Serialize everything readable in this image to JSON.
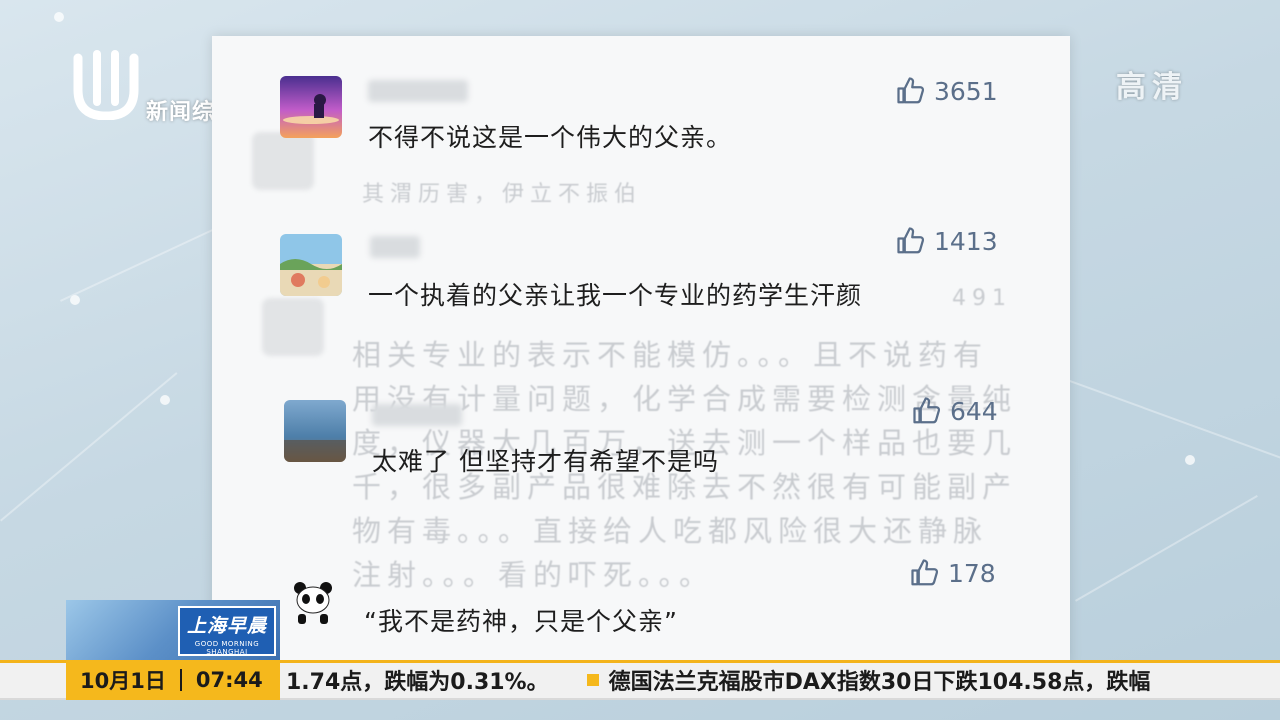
{
  "channel": {
    "logo_text": "新闻综合",
    "hd_label": "高清"
  },
  "comments": [
    {
      "avatar": "sunset-avatar",
      "likes": "3651",
      "text": "不得不说这是一个伟大的父亲。"
    },
    {
      "avatar": "landscape-avatar",
      "likes": "1413",
      "text": "一个执着的父亲让我一个专业的药学生汗颜"
    },
    {
      "avatar": "sea-avatar",
      "likes": "644",
      "text": "太难了 但坚持才有希望不是吗"
    },
    {
      "avatar": "panda-avatar",
      "likes": "178",
      "text": "“我不是药神，只是个父亲”"
    }
  ],
  "background_text": {
    "line1": "其渭历害，伊立不振伯",
    "line2": "491",
    "line3": "相关专业的表示不能模仿。。。且不说药有",
    "line4": "用没有计量问题，化学合成需要检测含量纯",
    "line5": "度，仪器大几百万，送去测一个样品也要几",
    "line6": "千，很多副产品很难除去不然很有可能副产",
    "line7": "物有毒。。。直接给人吃都风险很大还静脉",
    "line8": "注射。。。看的吓死。。。"
  },
  "program": {
    "title": "上海早晨",
    "subtitle": "GOOD MORNING SHANGHAI"
  },
  "ticker": {
    "date": "10月1日",
    "time": "07:44",
    "item1": "1.74点，跌幅为0.31%。",
    "item2": "德国法兰克福股市DAX指数30日下跌104.58点，跌幅"
  },
  "colors": {
    "ticker_accent": "#f5b81c",
    "like_color": "#5b6f8a"
  }
}
